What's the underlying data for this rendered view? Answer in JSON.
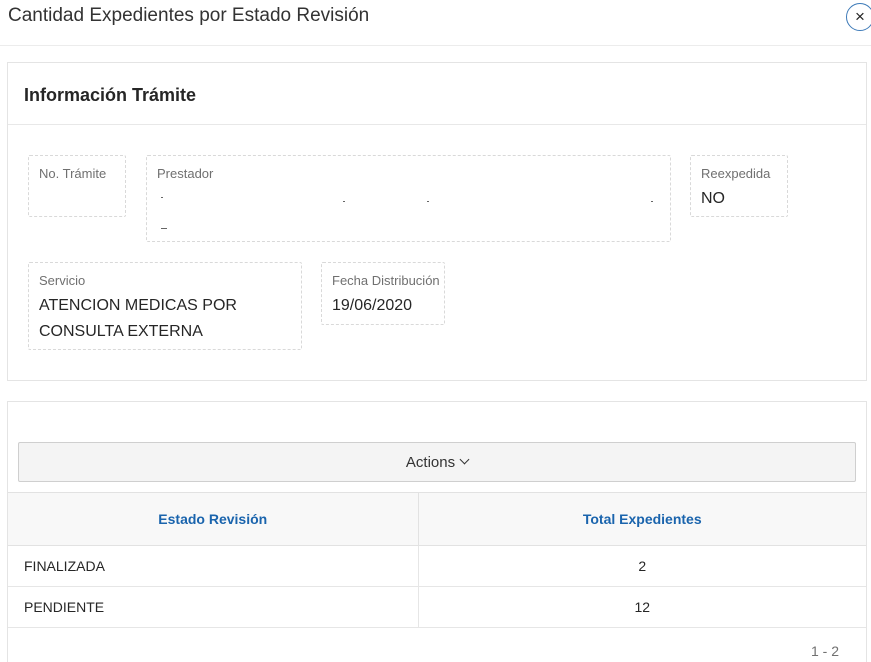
{
  "dialog": {
    "title": "Cantidad Expedientes por Estado Revisión",
    "close_icon": "×"
  },
  "info_region": {
    "title": "Información Trámite",
    "fields": {
      "tramite": {
        "label": "No. Trámite",
        "value": ""
      },
      "prestador": {
        "label": "Prestador",
        "value": ""
      },
      "reexpedida": {
        "label": "Reexpedida",
        "value": "NO"
      },
      "servicio": {
        "label": "Servicio",
        "value": "ATENCION MEDICAS POR CONSULTA EXTERNA"
      },
      "fecha": {
        "label": "Fecha Distribución",
        "value": "19/06/2020"
      }
    }
  },
  "report": {
    "actions_label": "Actions",
    "columns": [
      "Estado Revisión",
      "Total Expedientes"
    ],
    "rows": [
      {
        "estado": "FINALIZADA",
        "total": "2"
      },
      {
        "estado": "PENDIENTE",
        "total": "12"
      }
    ],
    "pagination": "1 - 2"
  },
  "colors": {
    "accent": "#1a64ad",
    "close_ring": "#3d7ab8"
  }
}
